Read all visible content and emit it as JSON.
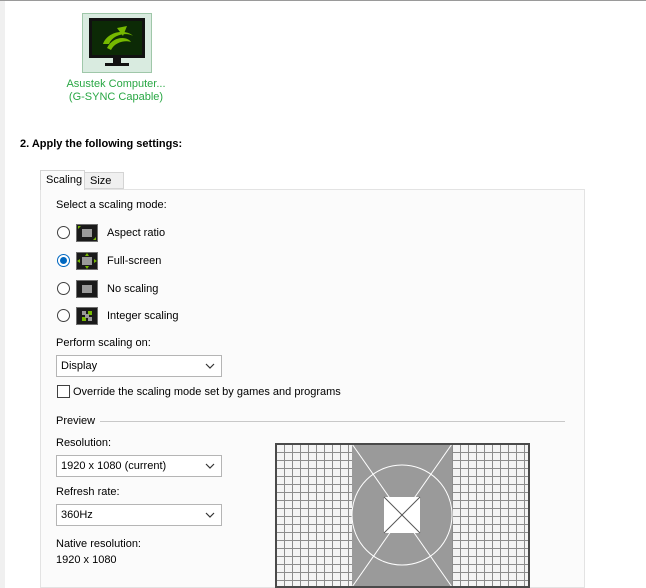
{
  "monitor": {
    "name": "Asustek Computer...",
    "capability": "(G-SYNC Capable)"
  },
  "section_title": "2. Apply the following settings:",
  "tabs": [
    {
      "label": "Scaling",
      "active": true
    },
    {
      "label": "Size",
      "active": false
    }
  ],
  "scaling": {
    "prompt": "Select a scaling mode:",
    "modes": [
      {
        "label": "Aspect ratio",
        "icon": "aspect-ratio-icon",
        "selected": false
      },
      {
        "label": "Full-screen",
        "icon": "full-screen-icon",
        "selected": true
      },
      {
        "label": "No scaling",
        "icon": "no-scaling-icon",
        "selected": false
      },
      {
        "label": "Integer scaling",
        "icon": "integer-scaling-icon",
        "selected": false
      }
    ],
    "perform_on_label": "Perform scaling on:",
    "perform_on_value": "Display",
    "override_label": "Override the scaling mode set by games and programs",
    "override_checked": false
  },
  "preview": {
    "heading": "Preview",
    "resolution_label": "Resolution:",
    "resolution_value": "1920 x 1080 (current)",
    "refresh_label": "Refresh rate:",
    "refresh_value": "360Hz",
    "native_label": "Native resolution:",
    "native_value": "1920 x 1080"
  },
  "colors": {
    "nvidia_green": "#76b900",
    "monitor_label": "#29a744",
    "radio_selected": "#0067c0"
  }
}
